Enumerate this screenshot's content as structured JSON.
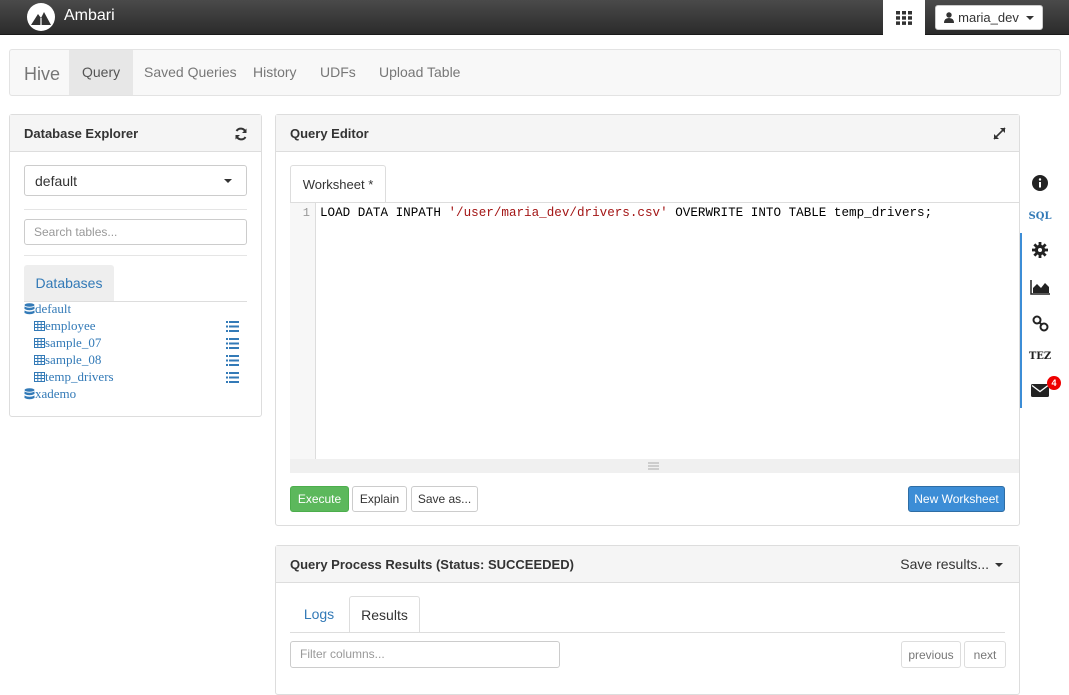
{
  "topbar": {
    "brand": "Ambari",
    "user": "maria_dev"
  },
  "nav": {
    "brand": "Hive",
    "tabs": [
      {
        "label": "Query",
        "active": true
      },
      {
        "label": "Saved Queries"
      },
      {
        "label": "History"
      },
      {
        "label": "UDFs"
      },
      {
        "label": "Upload Table"
      }
    ]
  },
  "db_explorer": {
    "title": "Database Explorer",
    "selected_db": "default",
    "search_placeholder": "Search tables...",
    "tab_label": "Databases",
    "databases": [
      {
        "name": "default",
        "tables": [
          "employee",
          "sample_07",
          "sample_08",
          "temp_drivers"
        ]
      },
      {
        "name": "xademo",
        "tables": []
      }
    ]
  },
  "editor": {
    "title": "Query Editor",
    "worksheet_tab": "Worksheet *",
    "line_number": "1",
    "code_before": "LOAD DATA INPATH ",
    "code_string": "'/user/maria_dev/drivers.csv'",
    "code_after": " OVERWRITE INTO TABLE temp_drivers;",
    "buttons": {
      "execute": "Execute",
      "explain": "Explain",
      "save_as": "Save as...",
      "new_worksheet": "New Worksheet"
    }
  },
  "rail": {
    "sql_label": "SQL",
    "tez_label": "TEZ",
    "mail_badge": "4"
  },
  "results": {
    "title": "Query Process Results (Status: SUCCEEDED)",
    "save_results": "Save results...",
    "tabs": [
      "Logs",
      "Results"
    ],
    "active_tab": "Results",
    "filter_placeholder": "Filter columns...",
    "previous": "previous",
    "next": "next"
  },
  "colors": {
    "link": "#337ab7",
    "success": "#5cb85c",
    "primary": "#3c8dd6",
    "topbar": "#333333"
  }
}
